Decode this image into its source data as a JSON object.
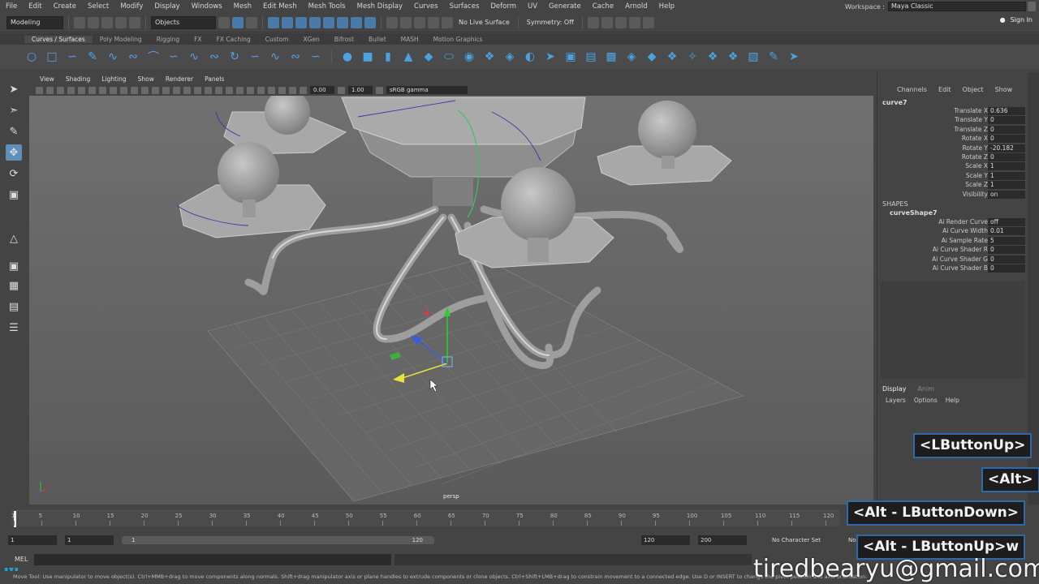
{
  "menu": [
    "File",
    "Edit",
    "Create",
    "Select",
    "Modify",
    "Display",
    "Windows",
    "Mesh",
    "Edit Mesh",
    "Mesh Tools",
    "Mesh Display",
    "Curves",
    "Surfaces",
    "Deform",
    "UV",
    "Generate",
    "Cache",
    "Arnold",
    "Help"
  ],
  "workspace": {
    "label": "Workspace :",
    "value": "Maya Classic"
  },
  "statusline": {
    "mode": "Modeling",
    "objects": "Objects",
    "live_surface": "No Live Surface",
    "symmetry": "Symmetry: Off",
    "sign_in": "Sign In"
  },
  "shelf_tabs": [
    "Curves / Surfaces",
    "Poly Modeling",
    "Rigging",
    "FX",
    "FX Caching",
    "Custom",
    "XGen",
    "Bifrost",
    "Bullet",
    "MASH",
    "Motion Graphics"
  ],
  "viewport": {
    "menu": [
      "View",
      "Shading",
      "Lighting",
      "Show",
      "Renderer",
      "Panels"
    ],
    "exposure": "0.00",
    "gamma": "1.00",
    "color_space": "sRGB gamma",
    "camera": "persp"
  },
  "channel_box": {
    "menu": [
      "Channels",
      "Edit",
      "Object",
      "Show"
    ],
    "object": "curve7",
    "attributes": [
      {
        "label": "Translate X",
        "value": "0.636"
      },
      {
        "label": "Translate Y",
        "value": "0"
      },
      {
        "label": "Translate Z",
        "value": "0"
      },
      {
        "label": "Rotate X",
        "value": "0"
      },
      {
        "label": "Rotate Y",
        "value": "-20.182"
      },
      {
        "label": "Rotate Z",
        "value": "0"
      },
      {
        "label": "Scale X",
        "value": "1"
      },
      {
        "label": "Scale Y",
        "value": "1"
      },
      {
        "label": "Scale Z",
        "value": "1"
      },
      {
        "label": "Visibility",
        "value": "on"
      }
    ],
    "shapes_title": "SHAPES",
    "shape_name": "curveShape7",
    "shape_attributes": [
      {
        "label": "Ai Render Curve",
        "value": "off"
      },
      {
        "label": "Ai Curve Width",
        "value": "0.01"
      },
      {
        "label": "Ai Sample Rate",
        "value": "5"
      },
      {
        "label": "Ai Curve Shader R",
        "value": "0"
      },
      {
        "label": "Ai Curve Shader G",
        "value": "0"
      },
      {
        "label": "Ai Curve Shader B",
        "value": "0"
      }
    ]
  },
  "layer_editor": {
    "tabs": [
      "Display",
      "Anim"
    ],
    "menu": [
      "Layers",
      "Options",
      "Help"
    ]
  },
  "timeline": {
    "ticks": [
      "1",
      "5",
      "10",
      "15",
      "20",
      "25",
      "30",
      "35",
      "40",
      "45",
      "50",
      "55",
      "60",
      "65",
      "70",
      "75",
      "80",
      "85",
      "90",
      "95",
      "100",
      "105",
      "110",
      "115",
      "120"
    ],
    "range_start": "1",
    "range_start2": "1",
    "slider_start": "1",
    "slider_end": "120",
    "end1": "120",
    "end2": "200",
    "character_set": "No Character Set",
    "no_label": "No"
  },
  "mel": {
    "label": "MEL"
  },
  "help_line": "Move Tool: Use manipulator to move object(s). Ctrl+MMB+drag to move components along normals. Shift+drag manipulator axis or plane handles to extrude components or clone objects. Ctrl+Shift+LMB+drag to constrain movement to a connected edge. Use D or INSERT to change the pivot position and axis orientation.",
  "overlays": {
    "k1": "<LButtonUp>",
    "k2": "<Alt>",
    "k3": "<Alt - LButtonDown>",
    "k4": "<Alt - LButtonUp>w",
    "email": "tiredbearyu@gmail.com"
  },
  "colors": {
    "accent": "#5d8fba",
    "viewport_bg": "#6b6b6b",
    "overlay_border": "#2f6aa8"
  }
}
